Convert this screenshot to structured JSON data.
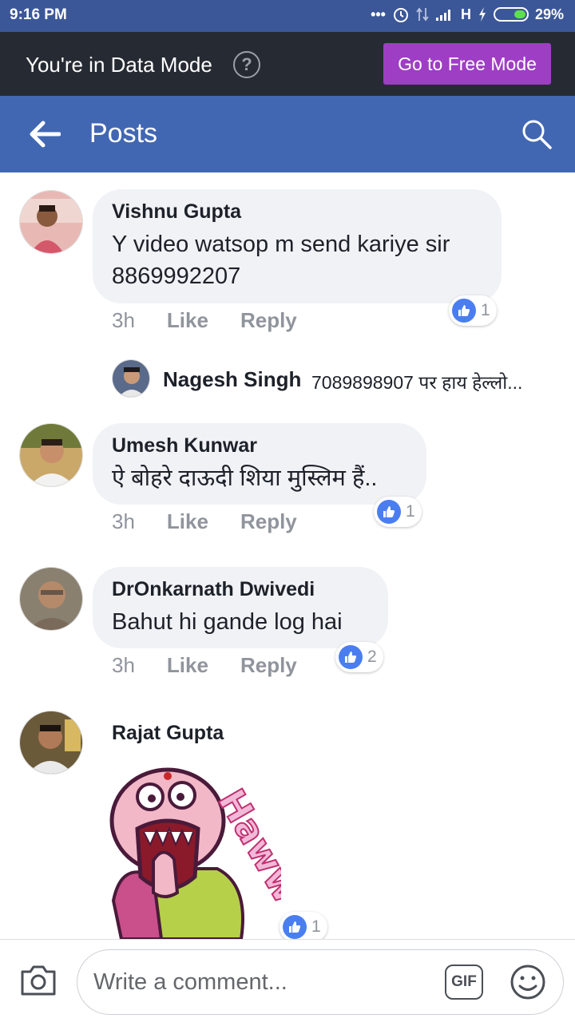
{
  "status_bar": {
    "time": "9:16 PM",
    "icons": [
      "more-dots-icon",
      "alarm-icon",
      "data-arrows-icon",
      "signal-icon",
      "network-h-icon",
      "charging-icon",
      "battery-icon"
    ],
    "network": "H",
    "battery": "29%"
  },
  "data_mode": {
    "text": "You're in Data Mode",
    "help_icon": "?",
    "button_label": "Go to Free Mode",
    "button_color": "#9e3ec4"
  },
  "header": {
    "title": "Posts",
    "bg_color": "#4267b2"
  },
  "comments": [
    {
      "name": "Vishnu Gupta",
      "text_line1": "Y video watsop m send kariye sir",
      "text_line2": "8869992207",
      "time": "3h",
      "like": "Like",
      "reply": "Reply",
      "reactions": "1"
    },
    {
      "name": "Umesh Kunwar",
      "text": "ऐ बोहरे दाऊदी शिया मुस्लिम हैं..",
      "time": "3h",
      "like": "Like",
      "reply": "Reply",
      "reactions": "1"
    },
    {
      "name": "DrOnkarnath Dwivedi",
      "text": "Bahut hi gande log hai",
      "time": "3h",
      "like": "Like",
      "reply": "Reply",
      "reactions": "2"
    },
    {
      "name": "Rajat Gupta",
      "sticker_text": "Haww",
      "reactions": "1"
    }
  ],
  "reply_preview": {
    "name": "Nagesh Singh",
    "text": "7089898907 पर हाय हेल्लो..."
  },
  "composer": {
    "placeholder": "Write a comment...",
    "gif_label": "GIF"
  }
}
